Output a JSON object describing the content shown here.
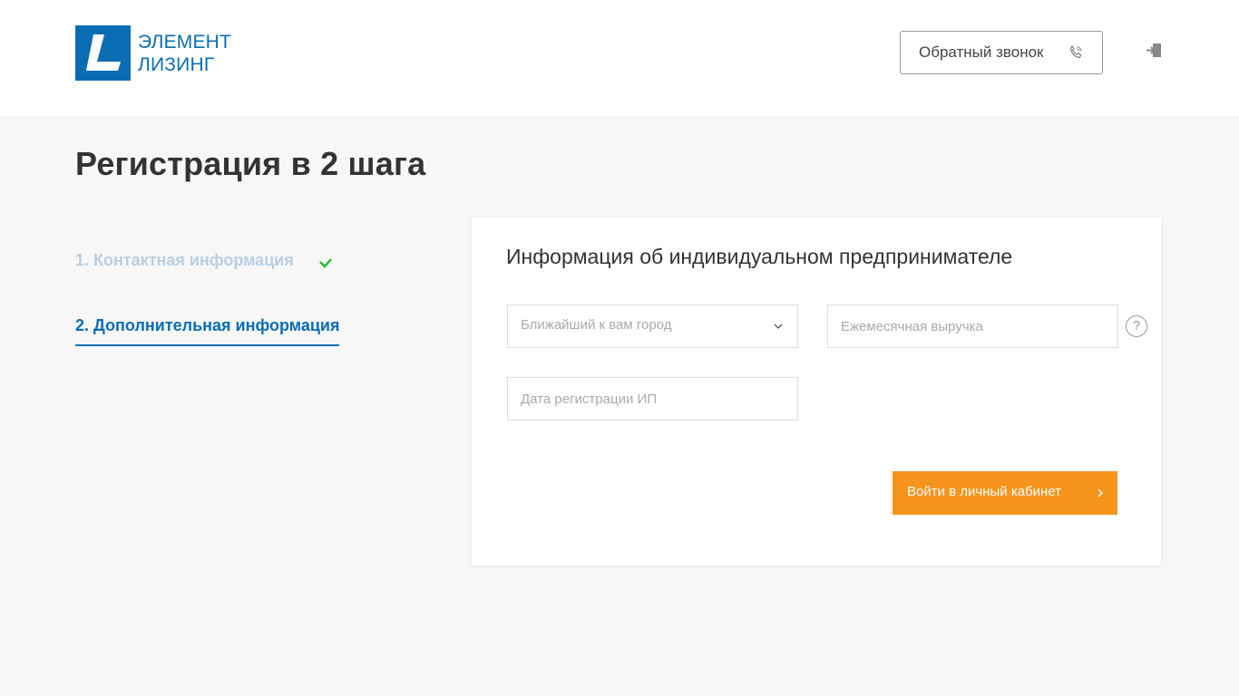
{
  "header": {
    "logo_line1": "ЭЛЕМЕНТ",
    "logo_line2": "ЛИЗИНГ",
    "callback_label": "Обратный звонок",
    "icons": {
      "phone": "phone-icon",
      "login": "login-icon"
    }
  },
  "page": {
    "title": "Регистрация в 2 шага"
  },
  "steps": [
    {
      "label": "1. Контактная информация",
      "state": "completed"
    },
    {
      "label": "2. Дополнительная информация",
      "state": "active"
    }
  ],
  "form": {
    "title": "Информация об индивидуальном предпринимателе",
    "city_placeholder": "Ближайший к вам город",
    "revenue_placeholder": "Ежемесячная выручка",
    "help_symbol": "?",
    "date_placeholder": "Дата регистрации ИП",
    "submit_label": "Войти в личный кабинет"
  },
  "colors": {
    "brand_blue": "#0a6db4",
    "accent_orange": "#f7941d",
    "check_green": "#2dbe2d",
    "background": "#f7f7f7"
  }
}
